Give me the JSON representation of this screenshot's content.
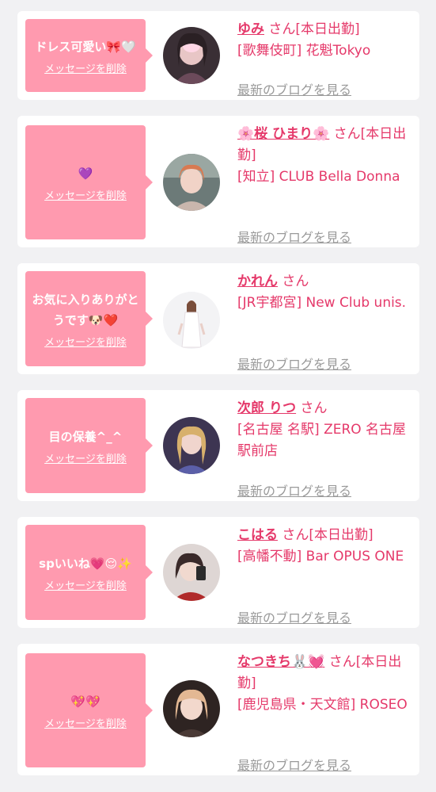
{
  "delete_label": "メッセージを削除",
  "blog_label": "最新のブログを見る",
  "colors": {
    "bubble": "#ff9aaf",
    "accent": "#e5396a",
    "muted": "#9a9a9a"
  },
  "cards": [
    {
      "message": "ドレス可愛い🎀🤍",
      "name": "ゆみ",
      "suffix": "さん[本日出勤]",
      "shop": "[歌舞伎町] 花魁Tokyo"
    },
    {
      "message": "💜",
      "name": "🌸桜 ひまり🌸",
      "suffix": "さん[本日出勤]",
      "shop": "[知立] CLUB Bella Donna"
    },
    {
      "message": "お気に入りありがとうです🐶❤️",
      "name": "かれん",
      "suffix": "さん",
      "shop": "[JR宇都宮] New Club unis."
    },
    {
      "message": "目の保養^_^",
      "name": "次郎 りつ",
      "suffix": "さん",
      "shop": "[名古屋 名駅] ZERO 名古屋駅前店"
    },
    {
      "message": "spいいね💗😌✨",
      "name": "こはる",
      "suffix": "さん[本日出勤]",
      "shop": "[高幡不動] Bar OPUS ONE"
    },
    {
      "message": "💖💖",
      "name": "なつきち🐰💓",
      "suffix": "さん[本日出勤]",
      "shop": "[鹿児島県・天文館] ROSEO"
    }
  ]
}
